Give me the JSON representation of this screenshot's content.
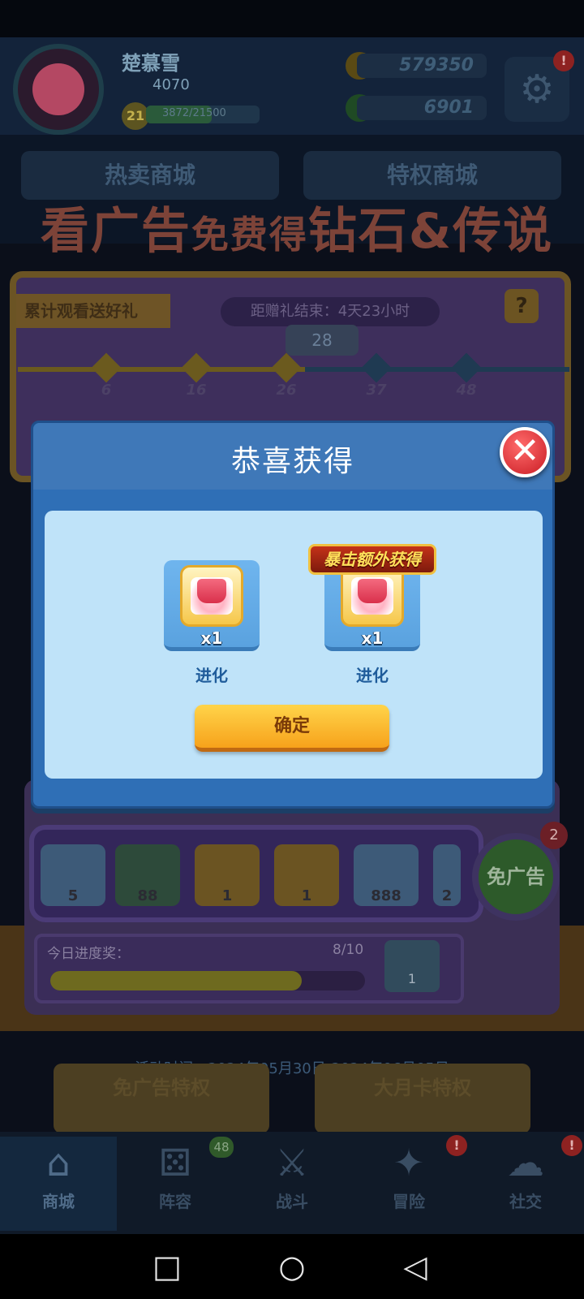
{
  "profile": {
    "name": "楚慕雪",
    "trophies": "4070",
    "level": "21",
    "xp_text": "3872/21500",
    "gold": "579350",
    "gems": "6901"
  },
  "shop_tabs": [
    "热卖商城",
    "特权商城"
  ],
  "banner": {
    "title_big_1": "看广告",
    "title_small": "免费得",
    "title_big_2": "钻石&传说"
  },
  "board": {
    "ribbon": "累计观看送好礼",
    "countdown": "距赠礼结束：4天23小时",
    "help": "?",
    "current_progress": "28",
    "milestones": [
      "6",
      "16",
      "26",
      "37",
      "48"
    ]
  },
  "reward_strip": {
    "counts": [
      "5",
      "88",
      "1",
      "1",
      "888",
      "2"
    ]
  },
  "ad_button": {
    "label": "免广告",
    "count": "2"
  },
  "daily": {
    "label": "今日进度奖：",
    "value": "8/10",
    "chest_count": "1",
    "progress_fraction": 0.8
  },
  "event_time": "活动时间：2024年05月30日-2024年06月05日",
  "promo_cards": [
    "免广告特权",
    "大月卡特权"
  ],
  "nav": {
    "items": [
      {
        "label": "商城",
        "icon": "store-icon"
      },
      {
        "label": "阵容",
        "icon": "dice-icon"
      },
      {
        "label": "战斗",
        "icon": "swords-icon"
      },
      {
        "label": "冒险",
        "icon": "compass-icon"
      },
      {
        "label": "社交",
        "icon": "chat-icon"
      }
    ],
    "lineup_badge": "48",
    "alert": "!"
  },
  "dialog": {
    "title": "恭喜获得",
    "close_symbol": "✕",
    "crit_tag": "暴击额外获得",
    "items": [
      {
        "qty": "x1",
        "name": "进化"
      },
      {
        "qty": "x1",
        "name": "进化"
      }
    ],
    "confirm_label": "确定"
  },
  "system_nav": {
    "recents": "□",
    "home": "○",
    "back": "◁"
  }
}
